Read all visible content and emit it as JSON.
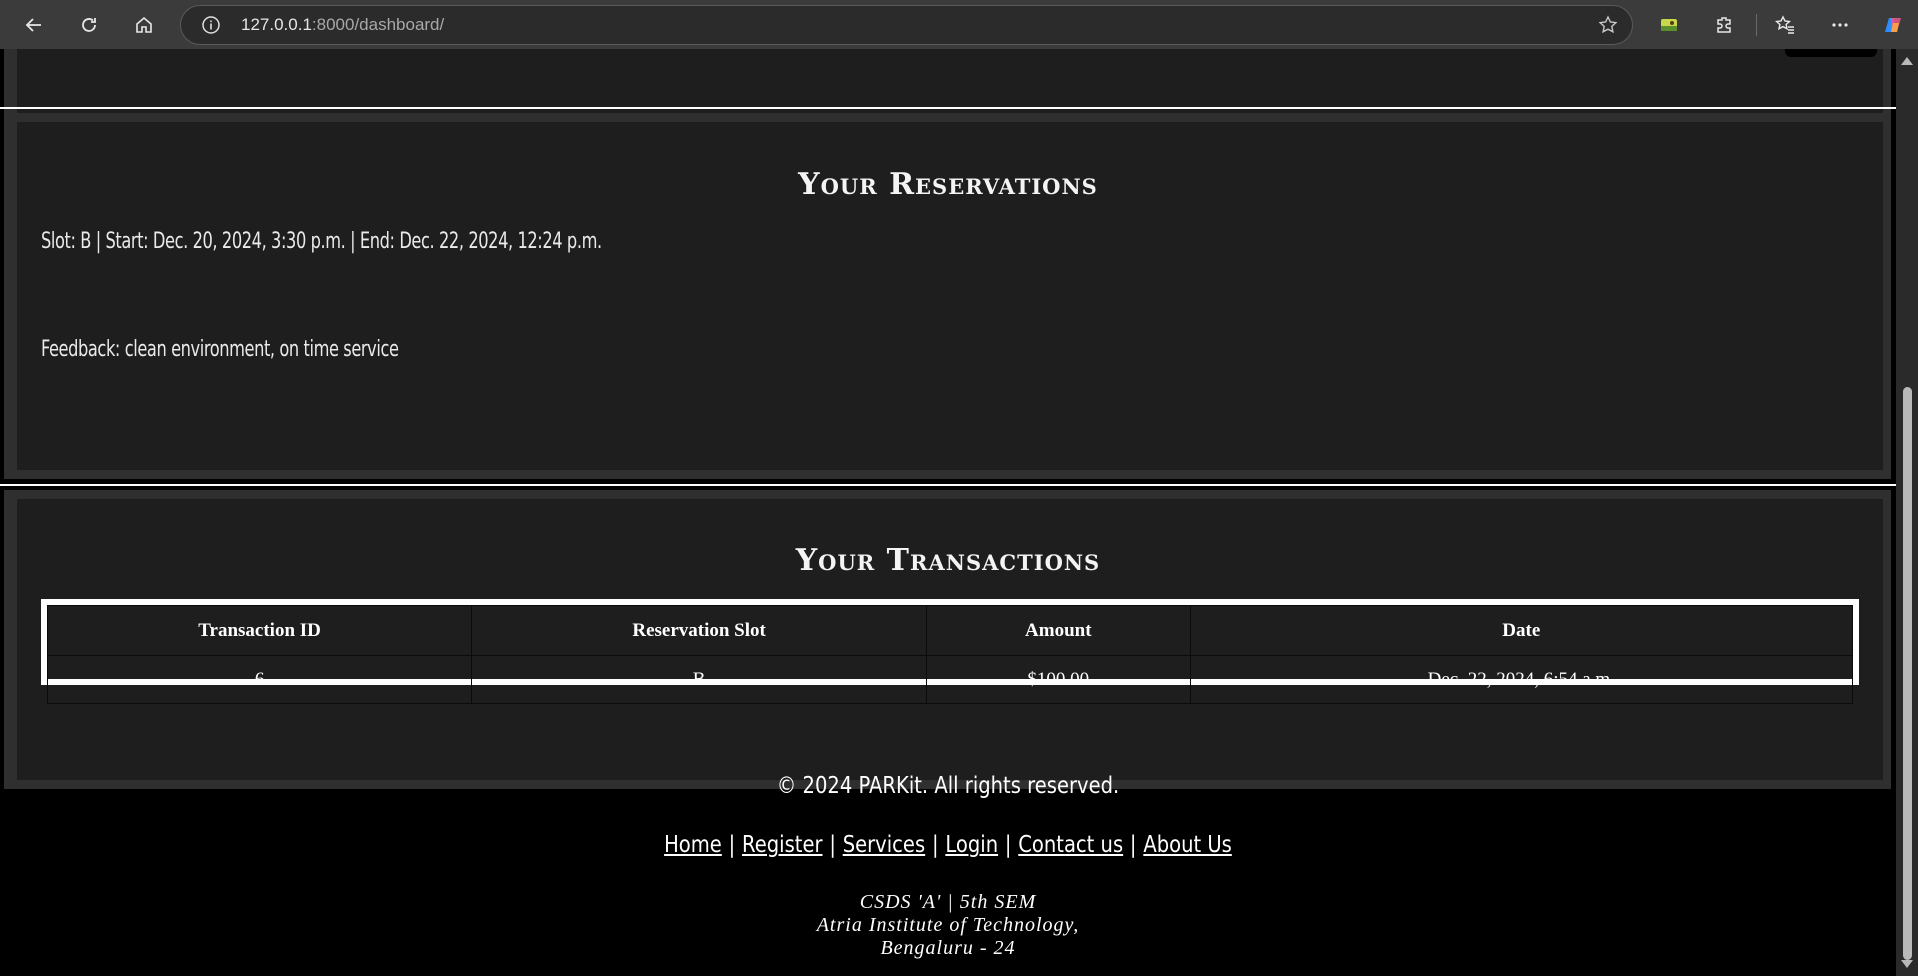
{
  "browser": {
    "url_host": "127.0.0.1",
    "url_rest": ":8000/dashboard/"
  },
  "icons": {
    "back": "back-arrow-icon",
    "reload": "reload-icon",
    "home": "home-icon",
    "info": "info-icon",
    "favorite": "star-icon",
    "ext1": "image-extension-icon",
    "extensions": "puzzle-icon",
    "favorites": "favorites-icon",
    "more": "ellipsis-icon",
    "copilot": "copilot-icon"
  },
  "reservations": {
    "title": "Your Reservations",
    "entry": "Slot: B | Start: Dec. 20, 2024, 3:30 p.m. | End: Dec. 22, 2024, 12:24 p.m.",
    "feedback": "Feedback: clean environment, on time service"
  },
  "transactions": {
    "title": "Your Transactions",
    "headers": [
      "Transaction ID",
      "Reservation Slot",
      "Amount",
      "Date"
    ],
    "rows": [
      [
        "6",
        "B",
        "$100.00",
        "Dec. 22, 2024, 6:54 a.m."
      ]
    ]
  },
  "footer": {
    "copyright": "© 2024 PARKit. All rights reserved.",
    "links": [
      "Home",
      "Register",
      "Services",
      "Login",
      "Contact us",
      "About Us"
    ],
    "separator": "|",
    "line1": "CSDS 'A' | 5th SEM",
    "line2": "Atria Institute of Technology,",
    "line3": "Bengaluru - 24"
  },
  "colors": {
    "page_bg": "#000000",
    "section_outer": "#2f2f2f",
    "section_inner": "#1e1e1e",
    "text": "#ffffff"
  }
}
